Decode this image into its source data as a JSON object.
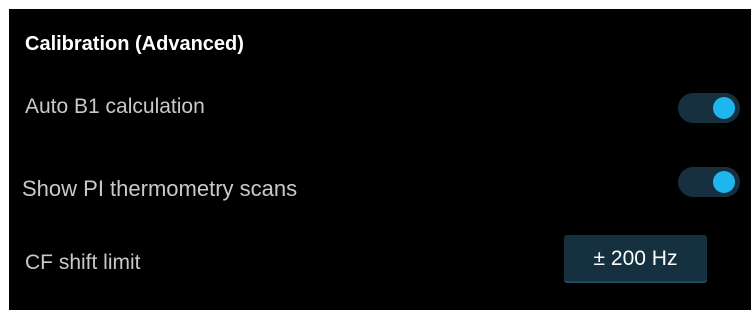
{
  "section": {
    "title": "Calibration (Advanced)"
  },
  "settings": {
    "auto_b1": {
      "label": "Auto B1 calculation",
      "enabled": true
    },
    "pi_thermometry": {
      "label": "Show PI thermometry scans",
      "enabled": true
    },
    "cf_shift_limit": {
      "label": "CF shift limit",
      "value": "± 200 Hz"
    }
  },
  "colors": {
    "background": "#000000",
    "accent": "#1fb6ef",
    "toggle_track": "#16303f",
    "field_bg": "#15303e"
  }
}
